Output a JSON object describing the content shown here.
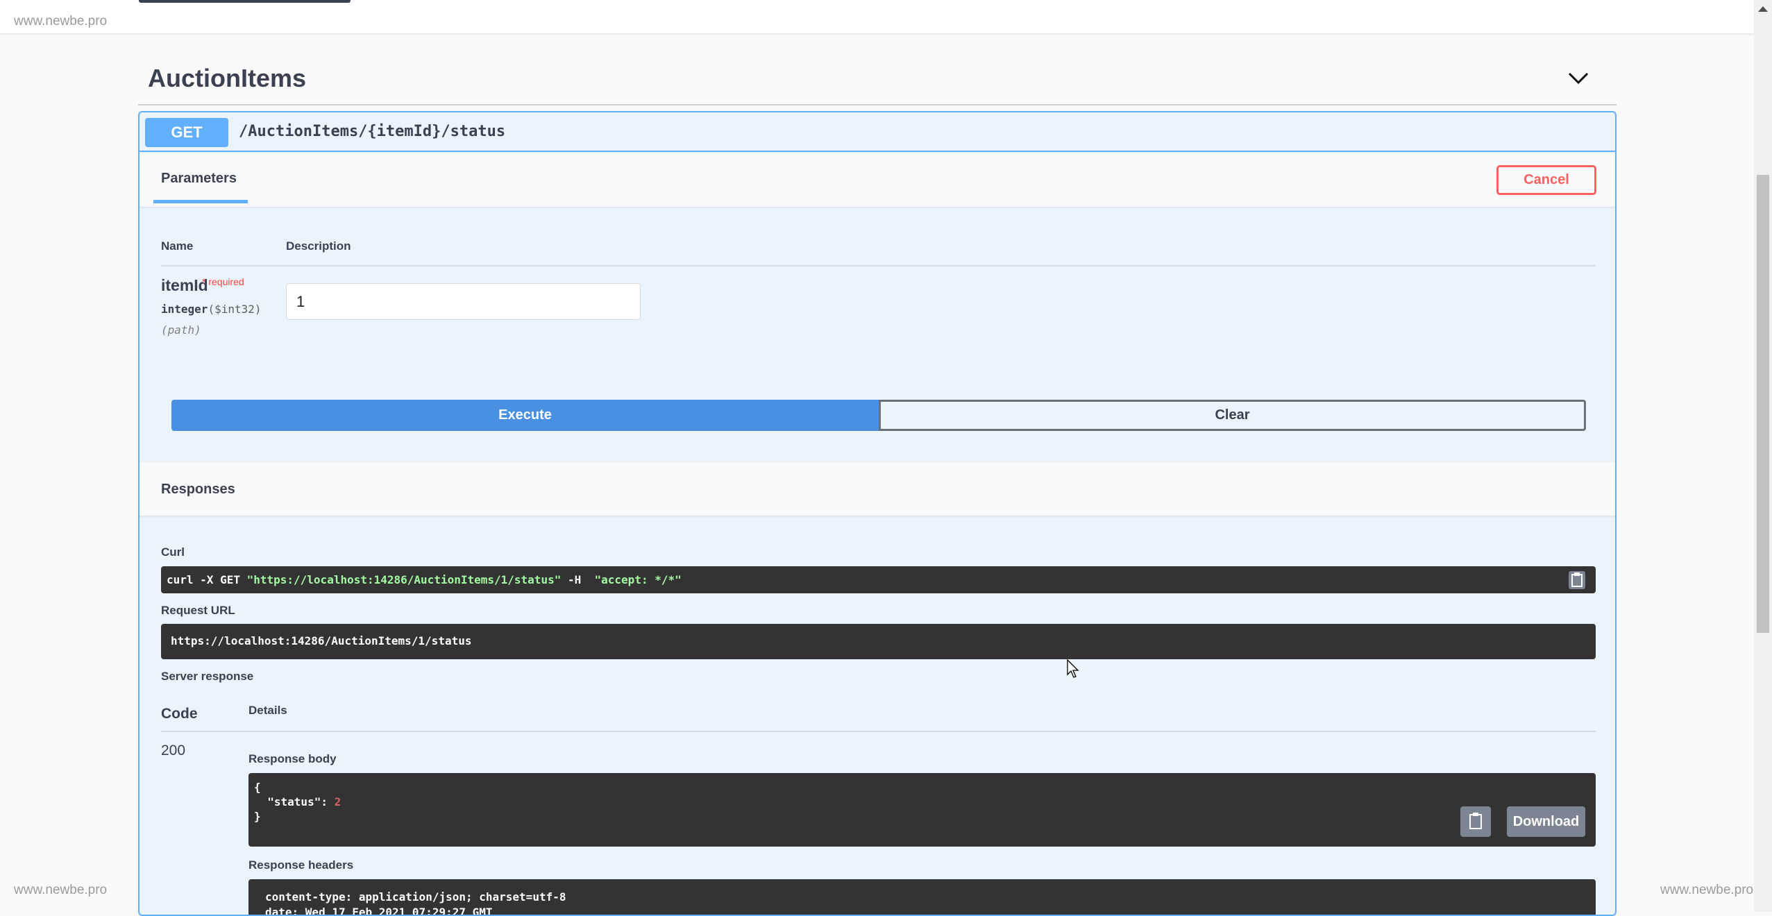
{
  "watermark": "www.newbe.pro",
  "section": {
    "title": "AuctionItems",
    "toggle_icon": "chevron-down-icon"
  },
  "operation": {
    "method": "GET",
    "path": "/AuctionItems/{itemId}/status",
    "color": "#61affe",
    "tab": "Parameters",
    "cancel_label": "Cancel",
    "params_header": {
      "name": "Name",
      "description": "Description"
    },
    "params": [
      {
        "name": "itemId",
        "required": "* required",
        "type": "integer",
        "format": "($int32)",
        "in": "(path)",
        "value": "1"
      }
    ],
    "execute_label": "Execute",
    "clear_label": "Clear"
  },
  "responses": {
    "title": "Responses",
    "curl_label": "Curl",
    "curl": {
      "prefix": "curl -X GET ",
      "url": "\"https://localhost:14286/AuctionItems/1/status\"",
      "mid": " -H  ",
      "header": "\"accept: */*\""
    },
    "request_url_label": "Request URL",
    "request_url": "https://localhost:14286/AuctionItems/1/status",
    "server_response_label": "Server response",
    "code_header": "Code",
    "details_header": "Details",
    "code": "200",
    "body_label": "Response body",
    "body": {
      "open": "{",
      "key": "  \"status\": ",
      "value": "2",
      "close": "}"
    },
    "download_label": "Download",
    "headers_label": "Response headers",
    "headers": [
      "content-type: application/json; charset=utf-8",
      "date: Wed 17 Feb 2021 07:29:27 GMT"
    ]
  }
}
